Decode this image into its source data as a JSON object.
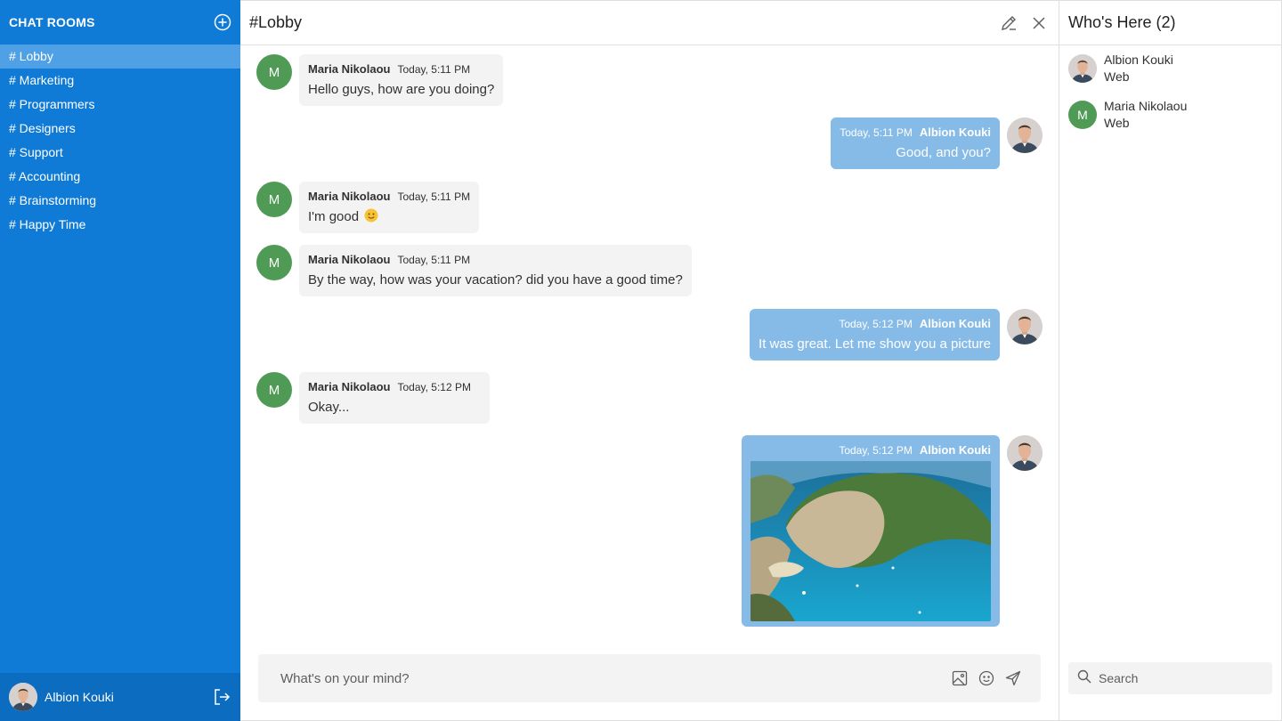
{
  "sidebar": {
    "title": "CHAT ROOMS",
    "rooms": [
      {
        "label": "# Lobby",
        "active": true
      },
      {
        "label": "# Marketing"
      },
      {
        "label": "# Programmers"
      },
      {
        "label": "# Designers"
      },
      {
        "label": "# Support"
      },
      {
        "label": "# Accounting"
      },
      {
        "label": "# Brainstorming"
      },
      {
        "label": "# Happy Time"
      }
    ],
    "user_name": "Albion Kouki"
  },
  "chat": {
    "title": "#Lobby",
    "messages": [
      {
        "author": "Maria Nikolaou",
        "time": "Today, 5:11 PM",
        "text": "Hello guys, how are you doing?",
        "avatar_letter": "M",
        "direction": "in"
      },
      {
        "author": "Albion Kouki",
        "time": "Today, 5:11 PM",
        "text": "Good, and you?",
        "direction": "out"
      },
      {
        "author": "Maria Nikolaou",
        "time": "Today, 5:11 PM",
        "text": "I'm good",
        "emoji": "slightly-smiling-face",
        "avatar_letter": "M",
        "direction": "in"
      },
      {
        "author": "Maria Nikolaou",
        "time": "Today, 5:11 PM",
        "text": "By the way, how was your vacation? did you have a good time?",
        "avatar_letter": "M",
        "direction": "in"
      },
      {
        "author": "Albion Kouki",
        "time": "Today, 5:12 PM",
        "text": "It was great. Let me show you a picture",
        "direction": "out"
      },
      {
        "author": "Maria Nikolaou",
        "time": "Today, 5:12 PM",
        "text": "Okay...",
        "avatar_letter": "M",
        "direction": "in"
      },
      {
        "author": "Albion Kouki",
        "time": "Today, 5:12 PM",
        "image": "beach-cove-photo",
        "direction": "out"
      }
    ],
    "composer_placeholder": "What's on your mind?"
  },
  "members": {
    "title": "Who's Here (2)",
    "list": [
      {
        "name": "Albion Kouki",
        "status": "Web"
      },
      {
        "name": "Maria Nikolaou",
        "status": "Web",
        "avatar_letter": "M"
      }
    ],
    "search_placeholder": "Search"
  },
  "colors": {
    "sidebar": "#0f7bd6",
    "sidebar_active": "#4fa0e4",
    "outgoing_bubble": "#86bbe8",
    "incoming_bubble": "#f3f3f3",
    "letter_avatar": "#4f9b55"
  }
}
